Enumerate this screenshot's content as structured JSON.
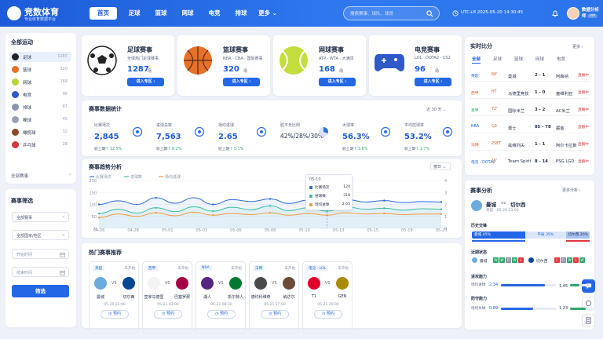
{
  "app": {
    "name": "竞数体育",
    "tagline": "专业体育数据平台"
  },
  "nav": [
    "首页",
    "足球",
    "篮球",
    "网球",
    "电竞",
    "排球",
    "更多"
  ],
  "search": {
    "placeholder": "搜索赛事、球队、球员"
  },
  "header": {
    "time": "UTC+8  2025-05-20 14:30:45",
    "user": "数据分析师",
    "vip": "VIP"
  },
  "sidebar": {
    "title": "全部运动",
    "items": [
      {
        "label": "足球",
        "count": "1287",
        "color": "#222"
      },
      {
        "label": "篮球",
        "count": "320",
        "color": "#e8702a"
      },
      {
        "label": "网球",
        "count": "168",
        "color": "#b7d33a"
      },
      {
        "label": "电竞",
        "count": "96",
        "color": "#2e59c7"
      },
      {
        "label": "排球",
        "count": "87",
        "color": "#8a96aa"
      },
      {
        "label": "棒球",
        "count": "45",
        "color": "#9aa2b2"
      },
      {
        "label": "橄榄球",
        "count": "32",
        "color": "#8b4a2b"
      },
      {
        "label": "乒乓球",
        "count": "28",
        "color": "#d23a3a"
      }
    ],
    "all": "全部赛事"
  },
  "filter": {
    "title": "赛事筛选",
    "type": "全部赛事",
    "region": "全部国家/地区",
    "start": "开始时间",
    "end": "结束时间",
    "button": "筛选"
  },
  "sports": [
    {
      "title": "足球赛事",
      "sub": "全球热门足球赛事",
      "count": "1287",
      "unit": "场",
      "btn": "进入专区"
    },
    {
      "title": "篮球赛事",
      "sub": "NBA · CBA · 国际赛事",
      "count": "320",
      "unit": "场",
      "btn": "进入专区"
    },
    {
      "title": "网球赛事",
      "sub": "ATP · WTA · 大满贯",
      "count": "168",
      "unit": "场",
      "btn": "进入专区"
    },
    {
      "title": "电竞赛事",
      "sub": "LOL · DOTA2 · CS2",
      "count": "96",
      "unit": "场",
      "btn": "进入专区"
    }
  ],
  "stats": {
    "title": "赛事数据统计",
    "range": "近 30 天",
    "items": [
      {
        "label": "比赛场次",
        "value": "2,845",
        "cmp": "较上期",
        "delta": "↑ 12.5%"
      },
      {
        "label": "进球总数",
        "value": "7,563",
        "cmp": "较上期",
        "delta": "↑ 8.2%"
      },
      {
        "label": "场均进球",
        "value": "2.65",
        "cmp": "较上期",
        "delta": "↑ 5.1%"
      },
      {
        "label": "胜平负比例",
        "value": "42%/28%/30%",
        "cmp": "",
        "delta": ""
      },
      {
        "label": "大球率",
        "value": "56.3%",
        "cmp": "较上期",
        "delta": "↑ 3.6%"
      },
      {
        "label": "平均控球率",
        "value": "53.2%",
        "cmp": "较上期",
        "delta": "↑ 2.7%"
      }
    ]
  },
  "trend": {
    "title": "赛事趋势分析",
    "period": "按日",
    "tooltip": {
      "date": "05-10",
      "rows": [
        {
          "label": "比赛场次",
          "value": "120"
        },
        {
          "label": "进球数",
          "value": "318"
        },
        {
          "label": "场均进球",
          "value": "2.65"
        }
      ]
    }
  },
  "chart_data": {
    "type": "line",
    "title": "赛事趋势分析",
    "x": [
      "04-26",
      "04-30",
      "05-04",
      "05-08",
      "05-12",
      "05-16",
      "05-20"
    ],
    "xticks": [
      "04-26",
      "04-28",
      "05-01",
      "05-03",
      "05-06",
      "05-08",
      "05-10",
      "05-13",
      "05-15",
      "05-18",
      "05-20"
    ],
    "x_tick_values": [
      "04-26",
      "04-28",
      "05-01",
      "05-03",
      "05-06",
      "05-08",
      "05-10",
      "05-13",
      "05-15",
      "05-18",
      "05-20"
    ],
    "ylim_left": [
      0,
      200
    ],
    "yticks_left": [
      0,
      50,
      100,
      150,
      200
    ],
    "ylim_right": [
      0,
      4
    ],
    "yticks_right": [
      0,
      1,
      2,
      3,
      4
    ],
    "series": [
      {
        "name": "比赛场次",
        "axis": "left",
        "color": "#2f6de0",
        "values": [
          100,
          115,
          100,
          128,
          105,
          128,
          100,
          120,
          112,
          123,
          104,
          118,
          102,
          121,
          110,
          116,
          108,
          112,
          110
        ]
      },
      {
        "name": "进球数",
        "axis": "left",
        "color": "#3bbfa0",
        "values": [
          62,
          80,
          64,
          86,
          70,
          90,
          72,
          88,
          78,
          94,
          74,
          86,
          72,
          90,
          80,
          84,
          76,
          82,
          80
        ]
      },
      {
        "name": "场均进球",
        "axis": "right",
        "color": "#f29a3a",
        "values": [
          0.9,
          1.2,
          1.0,
          1.3,
          1.05,
          1.35,
          1.1,
          1.25,
          1.15,
          1.3,
          1.1,
          1.25,
          1.1,
          1.3,
          1.2,
          1.25,
          1.15,
          1.2,
          1.2
        ]
      }
    ],
    "legend": "top-left",
    "grid": true
  },
  "hot": {
    "title": "热门赛事推荐",
    "matches": [
      {
        "league": "英超",
        "status": "未开始",
        "home": "曼城",
        "away": "切尔西",
        "time": "05-20 23:00",
        "btn": "预约",
        "hc": "#6cabdd",
        "ac": "#034694"
      },
      {
        "league": "西甲",
        "status": "未开始",
        "home": "皇家马德里",
        "away": "巴塞罗那",
        "time": "05-21 03:00",
        "btn": "预约",
        "hc": "#f3f3f3",
        "ac": "#a50044"
      },
      {
        "league": "NBA",
        "status": "未开始",
        "home": "湖人",
        "away": "凯尔特人",
        "time": "05-21 08:30",
        "btn": "预约",
        "hc": "#552583",
        "ac": "#007a33"
      },
      {
        "league": "法网",
        "status": "未开始",
        "home": "德约科维奇",
        "away": "纳达尔",
        "time": "05-21 17:00",
        "btn": "预约",
        "hc": "#4a4a4a",
        "ac": "#6b4a3a"
      },
      {
        "league": "电竞 · LOL",
        "status": "未开始",
        "home": "T1",
        "away": "GEN",
        "time": "05-21 20:00",
        "btn": "预约",
        "hc": "#e2012d",
        "ac": "#aa8a00"
      }
    ]
  },
  "live": {
    "title": "实时比分",
    "more": "更多",
    "tabs": [
      "全部",
      "足球",
      "篮球",
      "网球",
      "电竞"
    ],
    "rows": [
      {
        "league": "英超",
        "min": "68'",
        "home": "曼城",
        "score": "2 - 1",
        "away": "阿森纳",
        "status": "直播中",
        "lc": "#2367e6"
      },
      {
        "league": "西甲",
        "min": "HT",
        "home": "马德里竞技",
        "score": "1 - 0",
        "away": "塞维利亚",
        "status": "直播中",
        "lc": "#e05a2a"
      },
      {
        "league": "意甲",
        "min": "72'",
        "home": "国际米兰",
        "score": "3 - 2",
        "away": "AC米兰",
        "status": "直播中",
        "lc": "#2ea56a"
      },
      {
        "league": "NBA",
        "min": "Q3",
        "home": "勇士",
        "score": "85 - 78",
        "away": "掘金",
        "status": "直播中",
        "lc": "#2367e6"
      },
      {
        "league": "法网",
        "min": "2SET",
        "home": "兹维列夫",
        "score": "1 - 1",
        "away": "阿尔卡拉斯",
        "status": "直播中",
        "lc": "#e05a2a"
      },
      {
        "league": "电竞 · DOTA2",
        "min": "15'",
        "home": "Team Spirit",
        "score": "8 - 14",
        "away": "PSG.LGD",
        "status": "直播中",
        "lc": "#2367e6"
      }
    ]
  },
  "analysis": {
    "title": "赛事分析",
    "more": "更多分析",
    "home": "曼城",
    "vs": "vs",
    "away": "切尔西",
    "info": "英超 · 05-20 23:00",
    "h2h_title": "历史交锋",
    "h2h": {
      "home": "曼城 45%",
      "draw": "平局 35%",
      "away": "切尔西 20%"
    },
    "home_pct": 45,
    "draw_pct": 35,
    "away_pct": 20,
    "form_title": "近期状态",
    "form_home": "曼城",
    "form_away": "切尔西",
    "form_home_res": [
      "W",
      "W",
      "D",
      "W",
      "L"
    ],
    "form_away_res": [
      "L",
      "D",
      "W",
      "L",
      "W"
    ],
    "attack_title": "进攻能力",
    "attack_label": "场均进球",
    "attack_home": "2.34",
    "attack_away": "1.45",
    "attack_home_val": 2.34,
    "attack_away_val": 1.45,
    "defense_title": "防守能力",
    "defense_label": "场均失球",
    "defense_home": "0.89",
    "defense_away": "1.23",
    "defense_home_val": 0.89,
    "defense_away_val": 1.23
  }
}
